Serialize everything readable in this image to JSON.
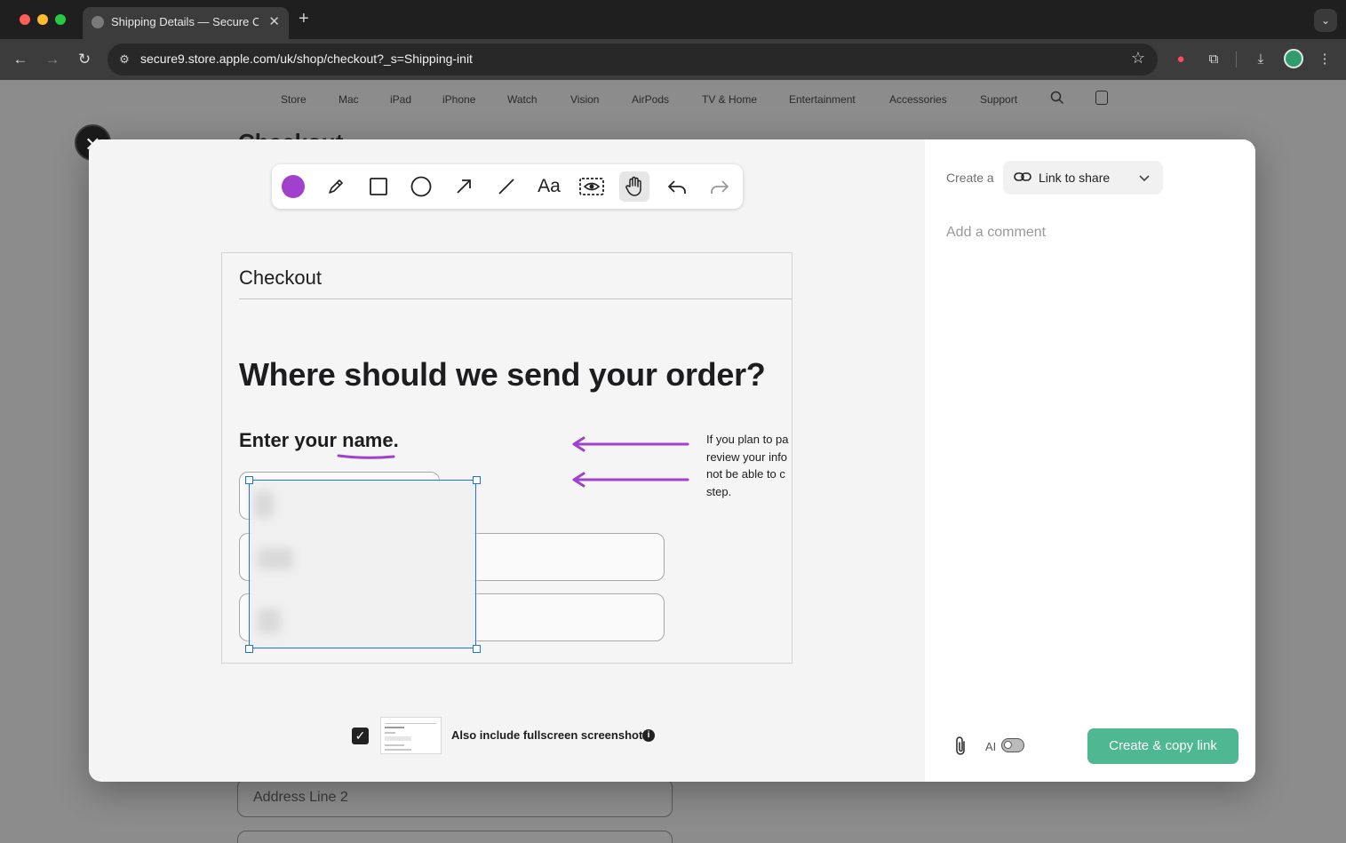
{
  "browser": {
    "tab_title": "Shipping Details — Secure Checkout",
    "url": "secure9.store.apple.com/uk/shop/checkout?_s=Shipping-init"
  },
  "apple_nav": {
    "items": [
      "Store",
      "Mac",
      "iPad",
      "iPhone",
      "Watch",
      "Vision",
      "AirPods",
      "TV & Home",
      "Entertainment",
      "Accessories",
      "Support"
    ]
  },
  "background_page": {
    "title": "Checkout",
    "address_line_2_label": "Address Line 2"
  },
  "toolbar": {
    "color": "#a040cc",
    "text_tool_label": "Aa",
    "icons": [
      "color-swatch-icon",
      "pen-icon",
      "rectangle-icon",
      "circle-icon",
      "arrow-icon",
      "line-icon",
      "text-icon",
      "blur-icon",
      "hand-icon",
      "undo-icon",
      "redo-icon"
    ],
    "active_tool": "hand-icon"
  },
  "preview": {
    "checkout_title": "Checkout",
    "headline": "Where should we send your order?",
    "enter_name": "Enter your name.",
    "note_lines": [
      "If you plan to pa",
      "review your info",
      "not be able to c",
      "step."
    ]
  },
  "footer": {
    "include_label": "Also include fullscreen screenshot",
    "include_checked": true
  },
  "sidebar": {
    "create_a": "Create a",
    "share_label": "Link to share",
    "comment_placeholder": "Add a comment",
    "ai_label": "AI",
    "ai_enabled": false,
    "cta_label": "Create & copy link",
    "cta_color": "#4db891"
  }
}
